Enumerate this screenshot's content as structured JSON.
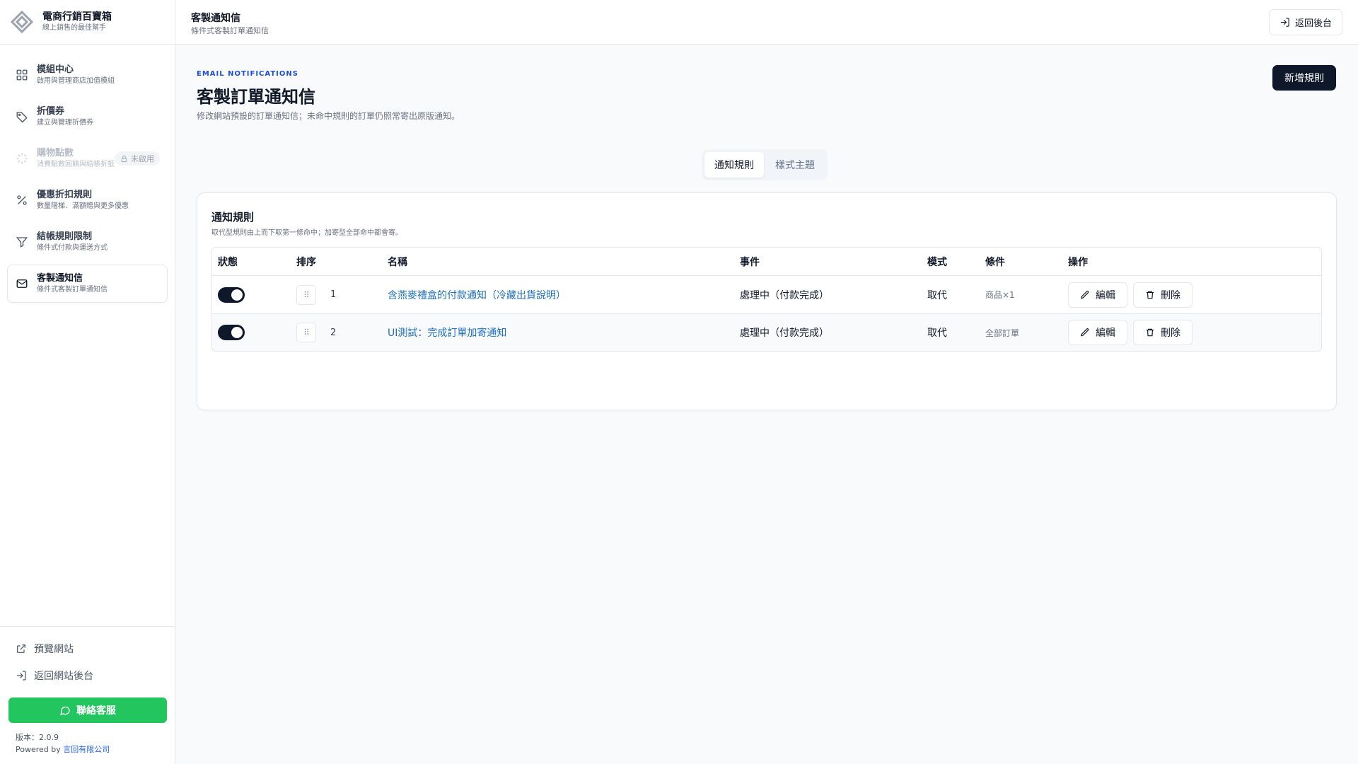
{
  "brand": {
    "title": "電商行銷百寶箱",
    "subtitle": "線上銷售的最佳幫手"
  },
  "sidebar": {
    "items": [
      {
        "label": "模組中心",
        "desc": "啟用與管理商店加值模組",
        "icon": "grid-icon",
        "state": "normal"
      },
      {
        "label": "折價券",
        "desc": "建立與管理折價券",
        "icon": "tag-icon",
        "state": "normal"
      },
      {
        "label": "購物點數",
        "desc": "消費點數回饋與結帳折抵",
        "icon": "loader-icon",
        "state": "disabled",
        "badge": "未啟用"
      },
      {
        "label": "優惠折扣規則",
        "desc": "數量階梯、滿額贈與更多優惠",
        "icon": "percent-icon",
        "state": "normal"
      },
      {
        "label": "結帳規則限制",
        "desc": "條件式付款與運送方式",
        "icon": "filter-icon",
        "state": "normal"
      },
      {
        "label": "客製通知信",
        "desc": "條件式客製訂單通知信",
        "icon": "mail-icon",
        "state": "active"
      }
    ],
    "footer": {
      "preview": "預覽網站",
      "back": "返回網站後台",
      "contact": "聯絡客服",
      "version": "版本：2.0.9",
      "powered_prefix": "Powered by ",
      "powered_company": "言回有限公司"
    }
  },
  "topbar": {
    "title": "客製通知信",
    "subtitle": "條件式客製訂單通知信",
    "back_button": "返回後台"
  },
  "main": {
    "eyebrow": "EMAIL NOTIFICATIONS",
    "title": "客製訂單通知信",
    "description": "修改網站預設的訂單通知信；未命中規則的訂單仍照常寄出原版通知。",
    "add_button": "新增規則",
    "tabs": [
      {
        "label": "通知規則",
        "active": true
      },
      {
        "label": "樣式主題",
        "active": false
      }
    ],
    "card": {
      "title": "通知規則",
      "subtitle": "取代型規則由上而下取第一條命中；加寄型全部命中都會寄。",
      "columns": [
        "狀態",
        "排序",
        "名稱",
        "事件",
        "模式",
        "條件",
        "操作"
      ],
      "rows": [
        {
          "enabled": true,
          "order": "1",
          "name": "含燕麥禮盒的付款通知（冷藏出貨說明）",
          "event": "處理中（付款完成）",
          "mode": "取代",
          "condition": "商品×1",
          "edit": "編輯",
          "delete": "刪除"
        },
        {
          "enabled": true,
          "order": "2",
          "name": "UI測試：完成訂單加寄通知",
          "event": "處理中（付款完成）",
          "mode": "取代",
          "condition": "全部訂單",
          "edit": "編輯",
          "delete": "刪除"
        }
      ]
    }
  },
  "colors": {
    "accent_dark": "#0f172a",
    "link": "#1e6fbf",
    "contact_green": "#22c55e",
    "eyebrow_blue": "#1d4ed8"
  }
}
